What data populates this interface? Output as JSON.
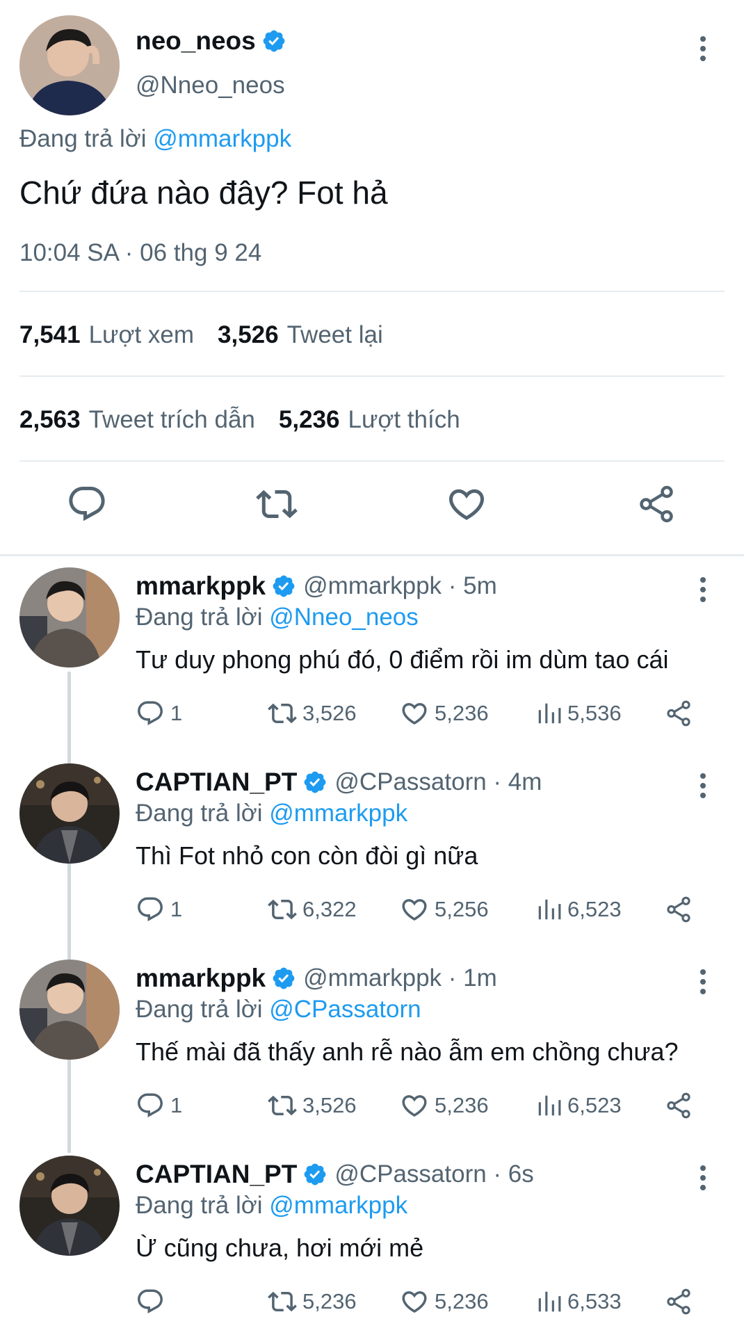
{
  "main_tweet": {
    "display_name": "neo_neos",
    "handle": "@Nneo_neos",
    "replying_prefix": "Đang trả lời",
    "replying_to": "@mmarkppk",
    "text": "Chứ đứa nào đây? Fot hả",
    "timestamp": "10:04 SA · 06 thg 9 24",
    "stats": {
      "views_count": "7,541",
      "views_label": "Lượt xem",
      "retweets_count": "3,526",
      "retweets_label": "Tweet lại",
      "quotes_count": "2,563",
      "quotes_label": "Tweet trích dẫn",
      "likes_count": "5,236",
      "likes_label": "Lượt thích"
    }
  },
  "replies": [
    {
      "display_name": "mmarkppk",
      "handle": "@mmarkppk · 5m",
      "replying_prefix": "Đang trả lời",
      "replying_to": "@Nneo_neos",
      "text": "Tư duy phong phú đó, 0 điểm rồi im dùm tao cái",
      "replies": "1",
      "retweets": "3,526",
      "likes": "5,236",
      "views": "5,536"
    },
    {
      "display_name": "CAPTIAN_PT",
      "handle": "@CPassatorn · 4m",
      "replying_prefix": "Đang trả lời",
      "replying_to": "@mmarkppk",
      "text": "Thì Fot nhỏ con còn đòi gì nữa",
      "replies": "1",
      "retweets": "6,322",
      "likes": "5,256",
      "views": "6,523"
    },
    {
      "display_name": "mmarkppk",
      "handle": "@mmarkppk · 1m",
      "replying_prefix": "Đang trả lời",
      "replying_to": "@CPassatorn",
      "text": "Thế mài đã thấy anh rễ nào ẫm em chồng chưa?",
      "replies": "1",
      "retweets": "3,526",
      "likes": "5,236",
      "views": "6,523"
    },
    {
      "display_name": "CAPTIAN_PT",
      "handle": "@CPassatorn · 6s",
      "replying_prefix": "Đang trả lời",
      "replying_to": "@mmarkppk",
      "text": "Ừ cũng chưa, hơi mới mẻ",
      "replies": "",
      "retweets": "5,236",
      "likes": "5,236",
      "views": "6,533"
    }
  ],
  "colors": {
    "accent": "#1d9bf0",
    "text": "#0f1419",
    "secondary": "#536471",
    "divider": "#e6ecf0"
  },
  "icons": [
    "verified-badge-icon",
    "more-options-icon",
    "reply-icon",
    "retweet-icon",
    "like-icon",
    "views-icon",
    "share-icon"
  ]
}
